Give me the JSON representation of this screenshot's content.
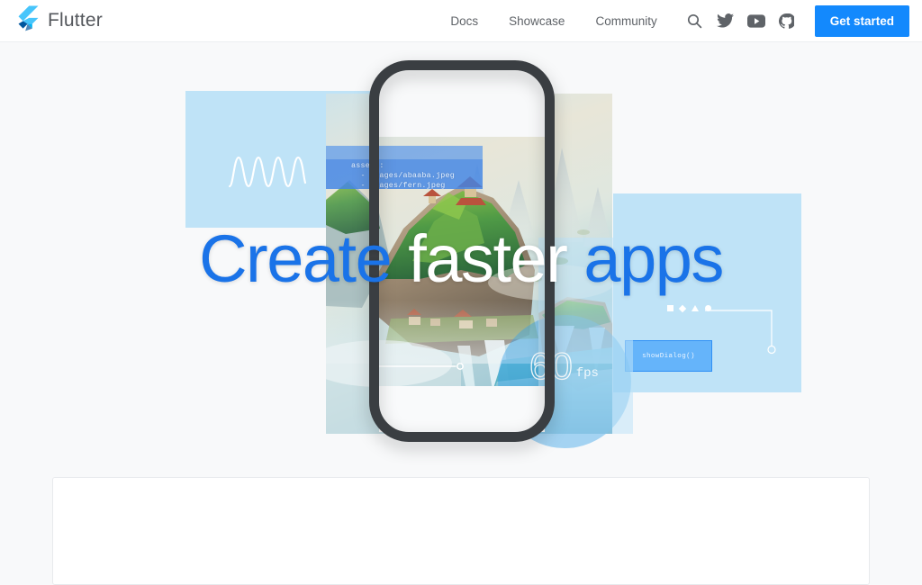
{
  "header": {
    "brand": {
      "name": "Flutter",
      "logo_icon": "flutter-logo-icon"
    },
    "nav_links": [
      {
        "label": "Docs"
      },
      {
        "label": "Showcase"
      },
      {
        "label": "Community"
      }
    ],
    "icons": [
      {
        "name": "search-icon"
      },
      {
        "name": "twitter-icon"
      },
      {
        "name": "youtube-icon"
      },
      {
        "name": "github-icon"
      }
    ],
    "cta_label": "Get started",
    "colors": {
      "cta_bg": "#1389fd",
      "nav_text": "#5f6368",
      "brand_text": "#54575c"
    }
  },
  "hero": {
    "headline": {
      "part1": "Create",
      "part2": "faster",
      "part3": "apps",
      "colors": {
        "blue": "#1a73e8",
        "white": "#ffffff"
      }
    },
    "code_overlay": "assets:\n  - images/abaaba.jpeg\n  - images/fern.jpeg",
    "fps": {
      "value": "60",
      "unit": "fps"
    },
    "dialog_button_label": "showDialog()",
    "decorations": {
      "wave_icon": "sine-wave-icon",
      "shapes": [
        "square-icon",
        "diamond-icon",
        "triangle-icon",
        "circle-icon"
      ],
      "slider_icon": "slider-icon",
      "connector_icon": "connector-line-icon"
    },
    "colors": {
      "panel": "#bfe3f7",
      "dialog_fill": "#65b4fa",
      "dialog_border": "#2f90f5",
      "phone_frame": "#3a3e42",
      "page_bg": "#f8f9fa"
    }
  },
  "content_card": {
    "bg": "#ffffff",
    "border": "#e8eaed"
  }
}
